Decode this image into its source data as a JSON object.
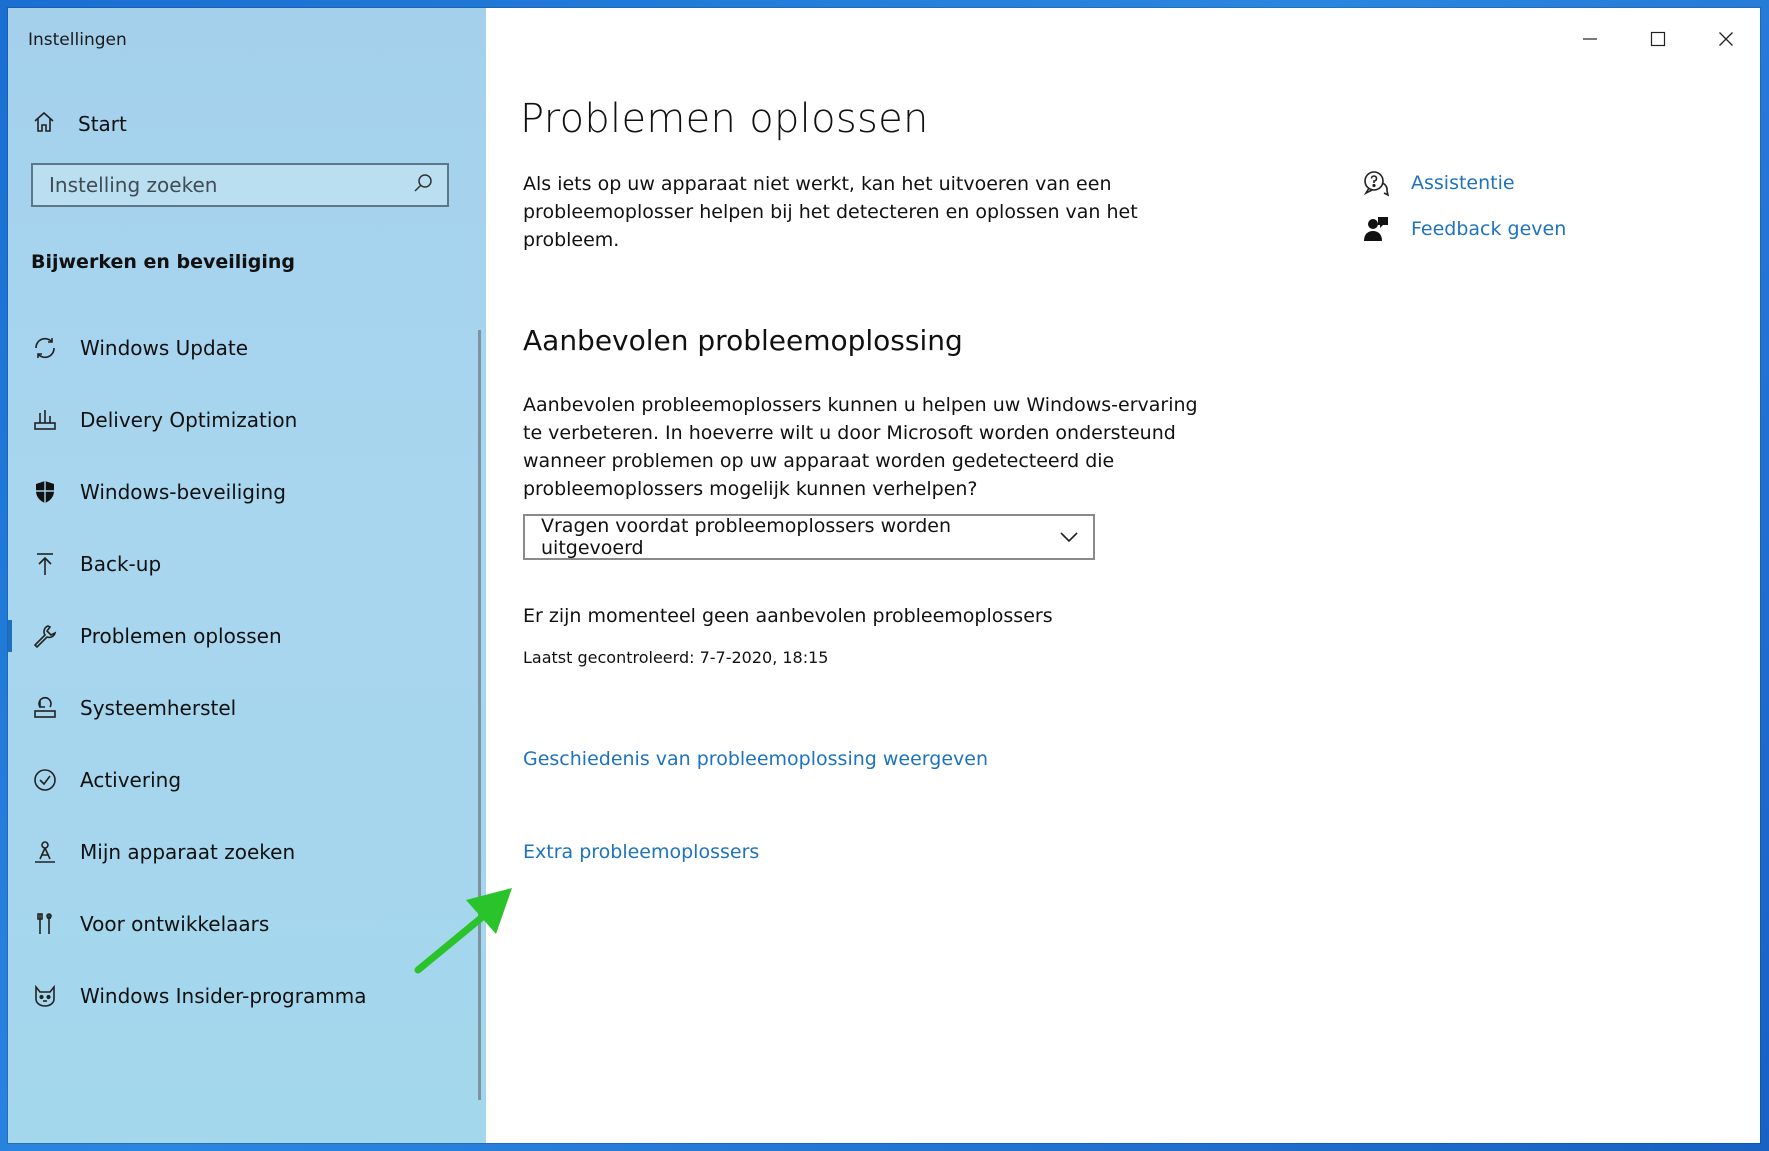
{
  "window": {
    "title": "Instellingen"
  },
  "sidebar": {
    "start_label": "Start",
    "search_placeholder": "Instelling zoeken",
    "section_title": "Bijwerken en beveiliging",
    "items": [
      {
        "label": "Windows Update",
        "icon": "sync-icon"
      },
      {
        "label": "Delivery Optimization",
        "icon": "delivery-optimization-icon"
      },
      {
        "label": "Windows-beveiliging",
        "icon": "shield-icon"
      },
      {
        "label": "Back-up",
        "icon": "backup-arrow-icon"
      },
      {
        "label": "Problemen oplossen",
        "icon": "wrench-icon",
        "active": true
      },
      {
        "label": "Systeemherstel",
        "icon": "recovery-icon"
      },
      {
        "label": "Activering",
        "icon": "check-circle-icon"
      },
      {
        "label": "Mijn apparaat zoeken",
        "icon": "find-device-icon"
      },
      {
        "label": "Voor ontwikkelaars",
        "icon": "developer-tools-icon"
      },
      {
        "label": "Windows Insider-programma",
        "icon": "insider-cat-icon"
      }
    ]
  },
  "main": {
    "title": "Problemen oplossen",
    "intro": "Als iets op uw apparaat niet werkt, kan het uitvoeren van een probleemoplosser helpen bij het detecteren en oplossen van het probleem.",
    "recommended_heading": "Aanbevolen probleemoplossing",
    "recommended_desc": "Aanbevolen probleemoplossers kunnen u helpen uw Windows-ervaring te verbeteren. In hoeverre wilt u door Microsoft worden ondersteund wanneer problemen op uw apparaat worden gedetecteerd die probleemoplossers mogelijk kunnen verhelpen?",
    "dropdown_value": "Vragen voordat probleemoplossers worden uitgevoerd",
    "no_recommended": "Er zijn momenteel geen aanbevolen probleemoplossers",
    "last_checked": "Laatst gecontroleerd: 7-7-2020, 18:15",
    "history_link": "Geschiedenis van probleemoplossing weergeven",
    "extra_link": "Extra probleemoplossers"
  },
  "side_links": {
    "help_label": "Assistentie",
    "feedback_label": "Feedback geven"
  },
  "colors": {
    "sidebar_bg": "#a6d4ee",
    "link": "#1e73be",
    "annotation_arrow": "#2bc32b"
  }
}
